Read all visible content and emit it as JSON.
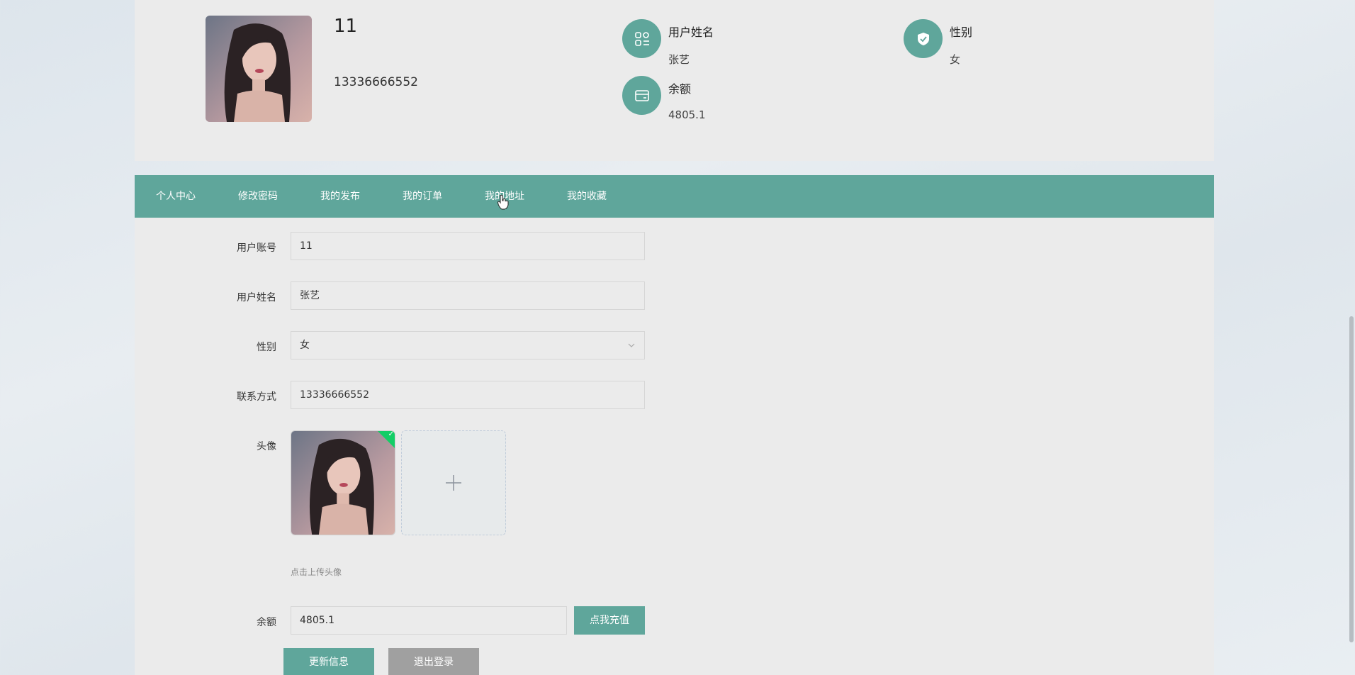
{
  "profile": {
    "username": "11",
    "phone": "13336666552",
    "fields": [
      {
        "label": "用户姓名",
        "value": "张艺",
        "icon": "user-list-icon"
      },
      {
        "label": "性别",
        "value": "女",
        "icon": "shield-check-icon"
      },
      {
        "label": "余额",
        "value": "4805.1",
        "icon": "wallet-icon"
      }
    ]
  },
  "nav": {
    "items": [
      {
        "label": "个人中心"
      },
      {
        "label": "修改密码"
      },
      {
        "label": "我的发布"
      },
      {
        "label": "我的订单"
      },
      {
        "label": "我的地址"
      },
      {
        "label": "我的收藏"
      }
    ]
  },
  "form": {
    "account_label": "用户账号",
    "account_value": "11",
    "name_label": "用户姓名",
    "name_value": "张艺",
    "gender_label": "性别",
    "gender_value": "女",
    "contact_label": "联系方式",
    "contact_value": "13336666552",
    "avatar_label": "头像",
    "upload_hint": "点击上传头像",
    "balance_label": "余额",
    "balance_value": "4805.1",
    "recharge_label": "点我充值",
    "update_label": "更新信息",
    "logout_label": "退出登录"
  },
  "colors": {
    "accent": "#5fa69b",
    "success": "#13ce66",
    "secondary_button": "#a0a0a0"
  }
}
